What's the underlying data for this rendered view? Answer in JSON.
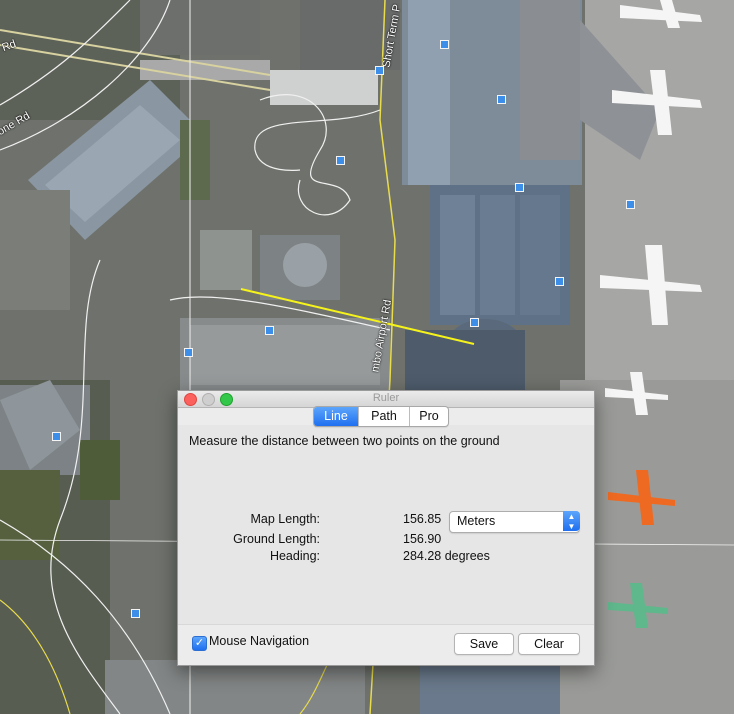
{
  "map": {
    "roads": {
      "rd_left": "Rd",
      "one_rd": "one Rd",
      "short_term": "Short Term P",
      "airport_rd": "mbo Airport Rd"
    },
    "measure_line_color": "#f5f21c"
  },
  "ruler": {
    "title": "Ruler",
    "tabs": [
      {
        "label": "Line",
        "active": true
      },
      {
        "label": "Path",
        "active": false
      },
      {
        "label": "Pro",
        "active": false
      }
    ],
    "description": "Measure the distance between two points on the ground",
    "fields": {
      "map_length_label": "Map Length:",
      "map_length_value": "156.85",
      "unit": "Meters",
      "ground_length_label": "Ground Length:",
      "ground_length_value": "156.90",
      "heading_label": "Heading:",
      "heading_value": "284.28 degrees"
    },
    "mouse_navigation": {
      "label": "Mouse Navigation",
      "checked": true
    },
    "buttons": {
      "save": "Save",
      "clear": "Clear"
    }
  }
}
